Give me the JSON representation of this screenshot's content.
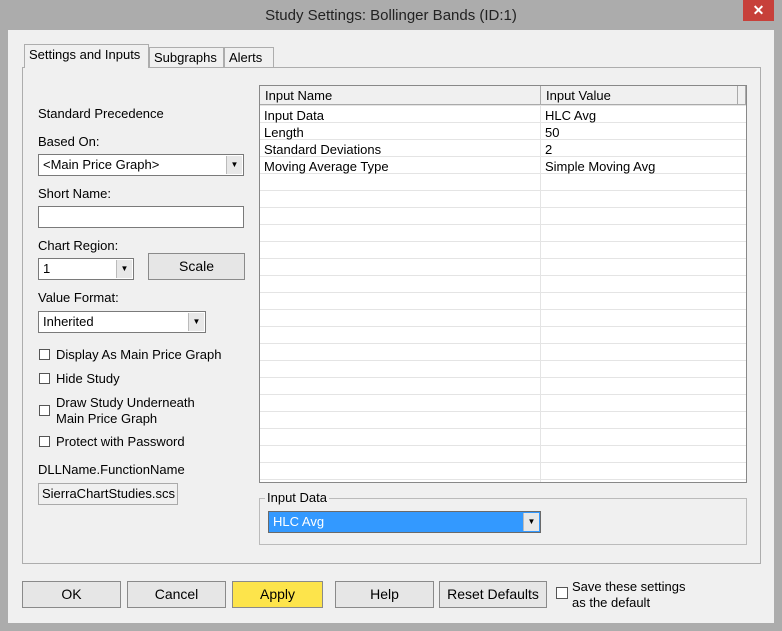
{
  "window": {
    "title": "Study Settings: Bollinger Bands (ID:1)",
    "close": "✕"
  },
  "tabs": [
    {
      "label": "Settings and Inputs"
    },
    {
      "label": "Subgraphs"
    },
    {
      "label": "Alerts"
    }
  ],
  "left": {
    "standard_precedence": "Standard Precedence",
    "based_on_label": "Based On:",
    "based_on_value": "<Main Price Graph>",
    "short_name_label": "Short Name:",
    "short_name_value": "",
    "chart_region_label": "Chart Region:",
    "chart_region_value": "1",
    "scale_button": "Scale",
    "value_format_label": "Value Format:",
    "value_format_value": "Inherited",
    "checkboxes": [
      {
        "label": "Display As Main Price Graph",
        "checked": false
      },
      {
        "label": "Hide Study",
        "checked": false
      },
      {
        "label": "Draw Study Underneath",
        "label2": "Main Price Graph",
        "checked": false
      },
      {
        "label": "Protect with Password",
        "checked": false
      }
    ],
    "dll_label": "DLLName.FunctionName",
    "dll_value": "SierraChartStudies.scs"
  },
  "grid": {
    "headers": [
      "Input Name",
      "Input Value"
    ],
    "rows": [
      {
        "name": "Input Data",
        "value": "HLC Avg"
      },
      {
        "name": "Length",
        "value": "50"
      },
      {
        "name": "Standard Deviations",
        "value": "2"
      },
      {
        "name": "Moving Average Type",
        "value": "Simple Moving Avg"
      }
    ]
  },
  "input_group": {
    "label": "Input Data",
    "value": "HLC Avg"
  },
  "buttons": {
    "ok": "OK",
    "cancel": "Cancel",
    "apply": "Apply",
    "help": "Help",
    "reset": "Reset Defaults"
  },
  "save_default": {
    "line1": "Save these settings",
    "line2": "as the default",
    "checked": false
  },
  "colors": {
    "apply": "#fde44b",
    "selection": "#3399ff",
    "close": "#c7403a"
  }
}
